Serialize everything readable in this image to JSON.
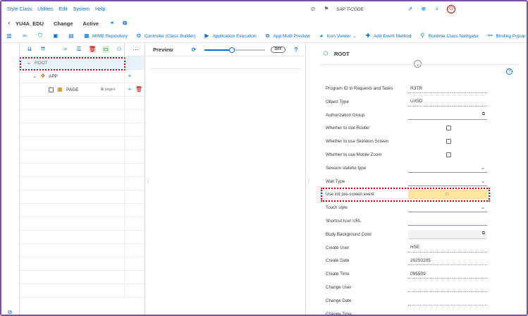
{
  "menu": [
    "Style Class",
    "Utilities",
    "Edit",
    "System",
    "Help"
  ],
  "tcode": "SAP T-CODE",
  "title": {
    "app": "YU4A_EDU",
    "mode": "Change",
    "status": "Active"
  },
  "toolbar": [
    {
      "label": "MIME Repository",
      "icon": "mime-icon"
    },
    {
      "label": "Controller (Class Builder)",
      "icon": "controller-icon"
    },
    {
      "label": "Application Execution",
      "icon": "execute-icon"
    },
    {
      "label": "App Multi Preview",
      "icon": "preview-icon"
    },
    {
      "label": "Icon Viewer",
      "icon": "icon-viewer-icon"
    },
    {
      "label": "Add Event Method",
      "icon": "add-icon"
    },
    {
      "label": "Runtime Class Navigator",
      "icon": "navigator-icon"
    },
    {
      "label": "Binding Popup",
      "icon": "binding-icon"
    }
  ],
  "tree": {
    "root": "ROOT",
    "app": "APP",
    "page": "PAGE",
    "page_tag": "pages",
    "more": "···"
  },
  "preview": {
    "title": "Preview",
    "toggle": "OFF"
  },
  "props": {
    "title": "ROOT",
    "rows": [
      {
        "label": "Program ID in Requests and Tasks",
        "value": "R3TR",
        "kind": "ro"
      },
      {
        "label": "Object Type",
        "value": "UX5D",
        "kind": "ro"
      },
      {
        "label": "Authorization Group",
        "value": "",
        "kind": "inp-help"
      },
      {
        "label": "Whether to use Router",
        "value": "",
        "kind": "chk"
      },
      {
        "label": "Whether to use Skeleton Screen",
        "value": "",
        "kind": "chk"
      },
      {
        "label": "Whether to use Mobile Zoom",
        "value": "",
        "kind": "chk"
      },
      {
        "label": "Session stateful type",
        "value": "",
        "kind": "sel"
      },
      {
        "label": "Wait Type",
        "value": "",
        "kind": "sel"
      },
      {
        "label": "Use init pre-screen event",
        "value": "",
        "kind": "highlight"
      },
      {
        "label": "Touch style",
        "value": "",
        "kind": "sel"
      },
      {
        "label": "Shortcut Icon URL",
        "value": "",
        "kind": "inp"
      },
      {
        "label": "Body Background Color",
        "value": "",
        "kind": "box-help"
      },
      {
        "label": "Create User",
        "value": "HSE",
        "kind": "ro"
      },
      {
        "label": "Create Date",
        "value": "20250205",
        "kind": "ro"
      },
      {
        "label": "Create Time",
        "value": "095509",
        "kind": "ro"
      },
      {
        "label": "Change User",
        "value": "",
        "kind": "ro"
      },
      {
        "label": "Change Date",
        "value": "",
        "kind": "ro"
      },
      {
        "label": "Change Time",
        "value": "",
        "kind": "ro"
      }
    ]
  },
  "colors": {
    "accent": "#0a6ed1",
    "highlight": "#ffe69c",
    "marker": "#cc0000",
    "border": "#7b4fa8"
  }
}
